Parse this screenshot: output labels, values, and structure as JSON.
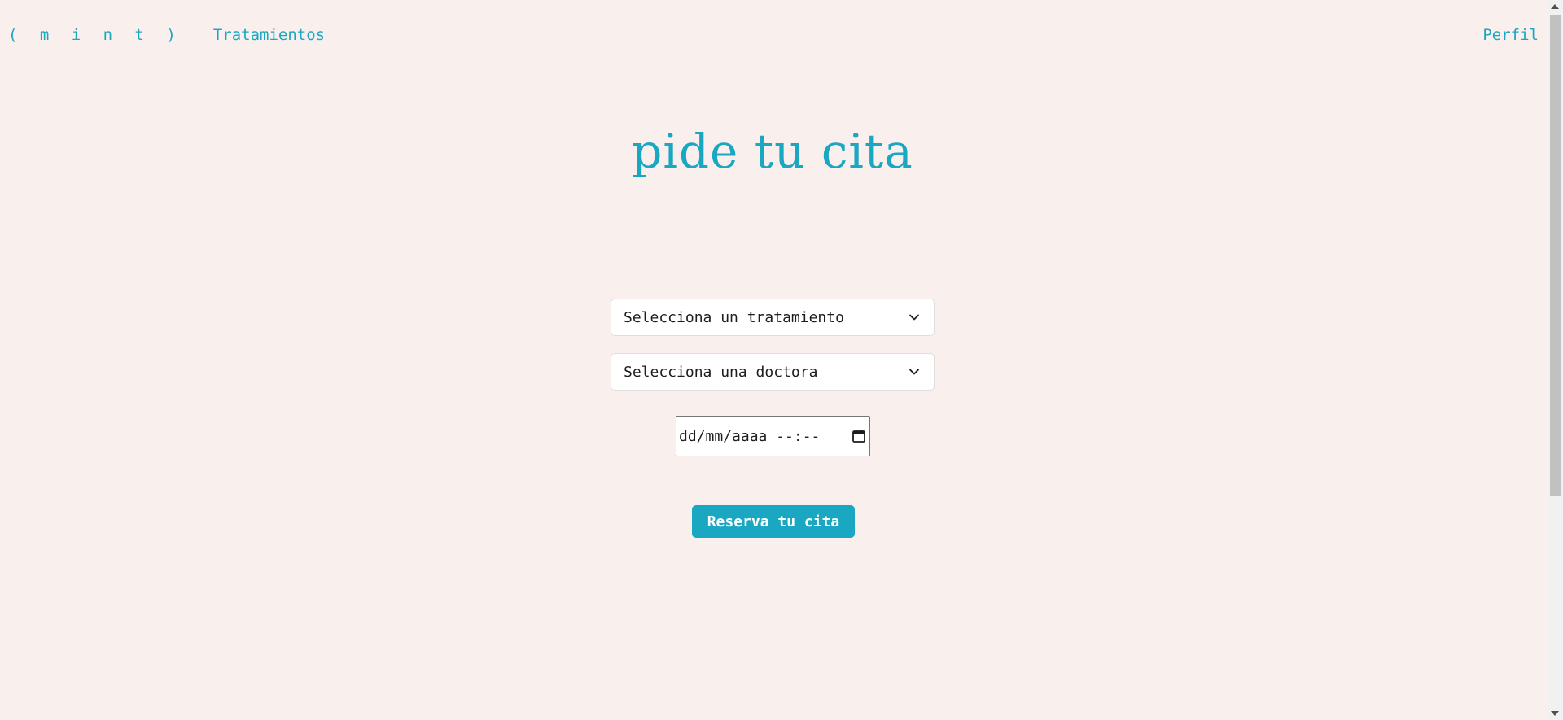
{
  "header": {
    "logo": "( m i n t )",
    "nav_treatments": "Tratamientos",
    "nav_profile": "Perfil"
  },
  "main": {
    "title": "pide tu cita",
    "treatment_select": "Selecciona un tratamiento",
    "doctor_select": "Selecciona una doctora",
    "datetime_placeholder": "dd/mm/aaaa --:--",
    "submit_label": "Reserva tu cita"
  },
  "colors": {
    "accent": "#19a7c2",
    "background": "#f9f0ee"
  },
  "icons": {
    "select_arrow": "chevron-down-icon",
    "date_picker": "calendar-icon"
  }
}
